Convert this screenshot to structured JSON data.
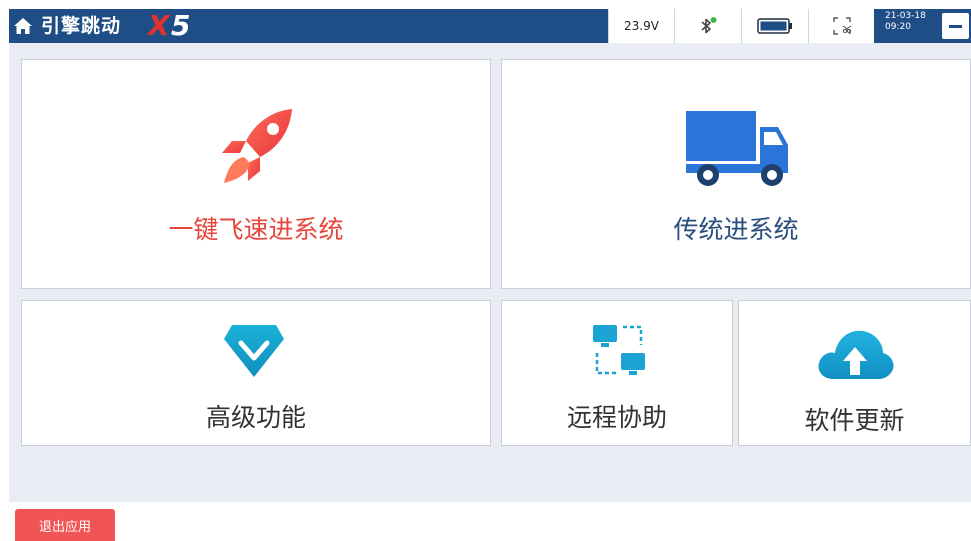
{
  "header": {
    "app_name": "引擎跳动",
    "brand_x": "X",
    "brand_5": "5",
    "voltage": "23.9V",
    "date": "21-03-18",
    "time": "09:20",
    "bluetooth_icon": "bluetooth-connected-icon",
    "battery_icon": "battery-full-icon",
    "screenshot_icon": "screenshot-icon",
    "home_icon": "home-icon",
    "colors": {
      "bar": "#1f4e86",
      "brand_accent": "#e23131"
    }
  },
  "tiles": {
    "quick": {
      "label": "一键飞速进系统",
      "icon": "rocket-icon",
      "color": "#e8453c"
    },
    "traditional": {
      "label": "传统进系统",
      "icon": "truck-icon",
      "color": "#2a4e7c"
    },
    "advanced": {
      "label": "高级功能",
      "icon": "diamond-icon"
    },
    "remote": {
      "label": "远程协助",
      "icon": "remote-computers-icon"
    },
    "update": {
      "label": "软件更新",
      "icon": "cloud-upload-icon"
    }
  },
  "footer": {
    "exit_label": "退出应用",
    "exit_color": "#f05454"
  }
}
